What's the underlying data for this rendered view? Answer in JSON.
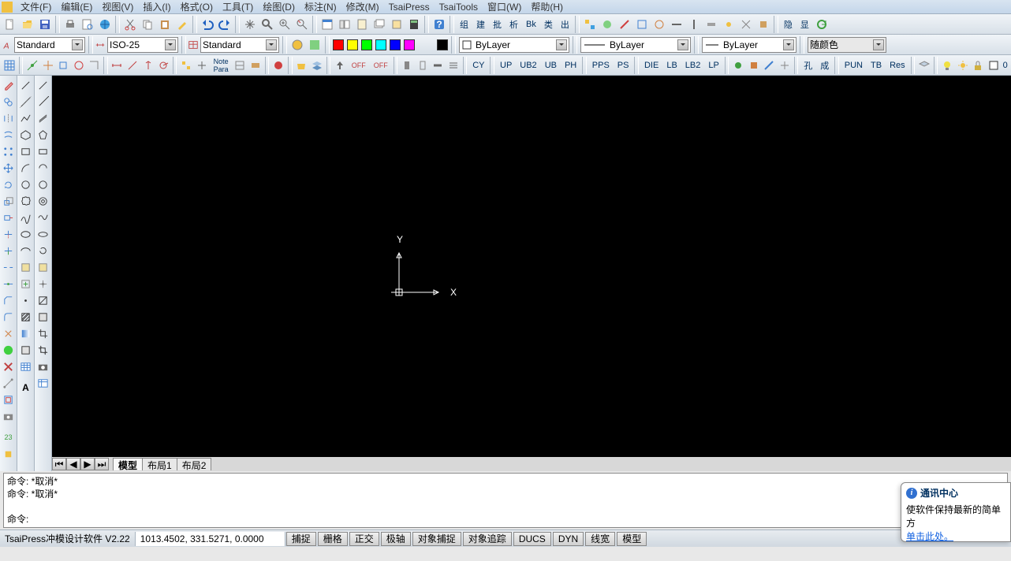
{
  "menu": {
    "file": "文件(F)",
    "edit": "编辑(E)",
    "view": "视图(V)",
    "insert": "插入(I)",
    "format": "格式(O)",
    "tools": "工具(T)",
    "draw": "绘图(D)",
    "annotate": "标注(N)",
    "modify": "修改(M)",
    "tsaipress": "TsaiPress",
    "tsaitools": "TsaiTools",
    "window": "窗口(W)",
    "help": "帮助(H)"
  },
  "row2": {
    "textstyle": "Standard",
    "dimstyle": "ISO-25",
    "tablestyle": "Standard",
    "layer": "ByLayer",
    "linetype": "ByLayer",
    "lineweight": "ByLayer",
    "plotcolor": "随颜色"
  },
  "row3": {
    "btns_left": [
      "组",
      "建",
      "批",
      "析",
      "Bk",
      "类",
      "出",
      "隐",
      "显"
    ],
    "btns_txt": [
      "CY",
      "UP",
      "UB2",
      "UB",
      "PH",
      "PPS",
      "PS",
      "DIE",
      "LB",
      "LB2",
      "LP"
    ],
    "btns_cn": [
      "孔",
      "成",
      "PUN",
      "TB",
      "Res"
    ]
  },
  "layout_tabs": {
    "model": "模型",
    "layout1": "布局1",
    "layout2": "布局2"
  },
  "cmd": {
    "line1": "命令:  *取消*",
    "line2": "命令:  *取消*",
    "prompt": "命令:"
  },
  "status": {
    "product": "TsaiPress冲模设计软件 V2.22",
    "coords": "1013.4502, 331.5271, 0.0000",
    "buttons": [
      "捕捉",
      "栅格",
      "正交",
      "极轴",
      "对象捕捉",
      "对象追踪",
      "DUCS",
      "DYN",
      "线宽",
      "模型"
    ]
  },
  "notif": {
    "title": "通讯中心",
    "body": "使软件保持最新的简单方",
    "link": "单击此处。"
  },
  "layer_count": "0",
  "ucs": {
    "x": "X",
    "y": "Y"
  }
}
